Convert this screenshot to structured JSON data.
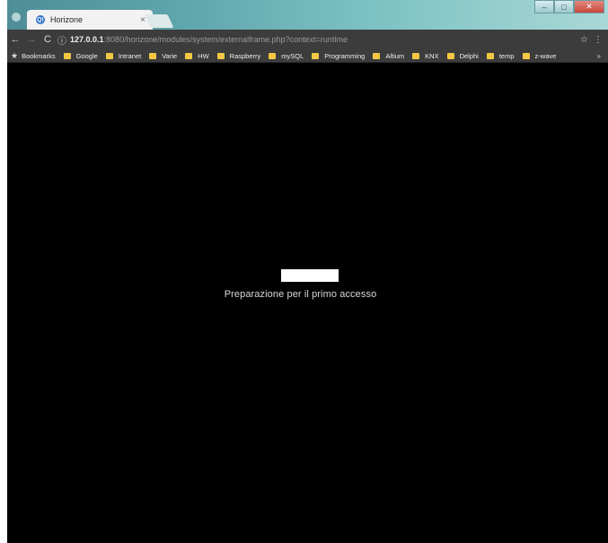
{
  "tab": {
    "title": "Horizone",
    "favicon": "Q!",
    "close": "×"
  },
  "window_controls": {
    "minimize": "–",
    "maximize": "□",
    "close": "✕"
  },
  "toolbar": {
    "back": "←",
    "forward": "→",
    "reload": "C",
    "info_icon": "ⓘ",
    "url_host": "127.0.0.1",
    "url_rest": ":8080/horizone/modules/system/externalframe.php?context=runtime",
    "star": "☆",
    "menu": "⋮"
  },
  "bookmarks": {
    "star": "★",
    "items": [
      "Bookmarks",
      "Google",
      "Intranet",
      "Varie",
      "HW",
      "Raspberry",
      "mySQL",
      "Programming",
      "Altium",
      "KNX",
      "Delphi",
      "temp",
      "z-wave"
    ],
    "more": "»"
  },
  "content": {
    "loading_text": "Preparazione per il primo accesso",
    "background": "#000000"
  }
}
